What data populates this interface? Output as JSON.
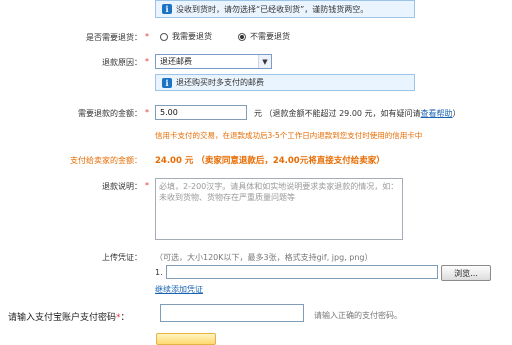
{
  "top_notice": {
    "text": "没收到货时，请勿选择“已经收到货”，谨防钱货两空。"
  },
  "need_return": {
    "label": "是否需要退货：",
    "required_mark": "*",
    "option_yes": "我需要退货",
    "option_no": "不需要退货",
    "selected": "option_no"
  },
  "refund_reason": {
    "label": "退款原因：",
    "required_mark": "*",
    "selected_value": "退还邮费"
  },
  "reason_notice": {
    "text": "退还购买时多支付的邮费"
  },
  "refund_amount": {
    "label": "需要退款的金额：",
    "required_mark": "*",
    "value": "5.00",
    "unit": "元",
    "hint_prefix": "（退款金额不能超过",
    "hint_amount": "29.00",
    "hint_suffix": "元，如有疑问请",
    "help_link": "查看帮助",
    "hint_close": "）",
    "credit_note": "信用卡支付的交易，在退款成功后3-5个工作日内退款到您支付时使用的信用卡中"
  },
  "seller_pay": {
    "label": "支付给卖家的金额：",
    "amount": "24.00 元",
    "note": "（卖家同意退款后，24.00元将直接支付给卖家）"
  },
  "refund_desc": {
    "label": "退款说明：",
    "required_mark": "*",
    "placeholder": "必填，2-200汉字。请具体和如实地说明要求卖家退款的情况，如：未收到货物、货物存在严重质量问题等"
  },
  "upload": {
    "label": "上传凭证：",
    "hint": "（可选，大小120K以下，最多3张，格式支持gif, jpg, png）",
    "index": "1.",
    "browse_label": "浏览...",
    "add_more_link": "继续添加凭证"
  },
  "password": {
    "label": "请输入支付宝账户支付密码",
    "required_mark": "*",
    "colon": "：",
    "hint": "请输入正确的支付密码。"
  },
  "colors": {
    "accent_blue": "#1a63b4",
    "orange": "#e76b00",
    "required_red": "#e4393c",
    "notice_bg": "#eaf4ff"
  },
  "icons": [
    "info-icon",
    "radio-icon",
    "dropdown-arrow-icon"
  ]
}
